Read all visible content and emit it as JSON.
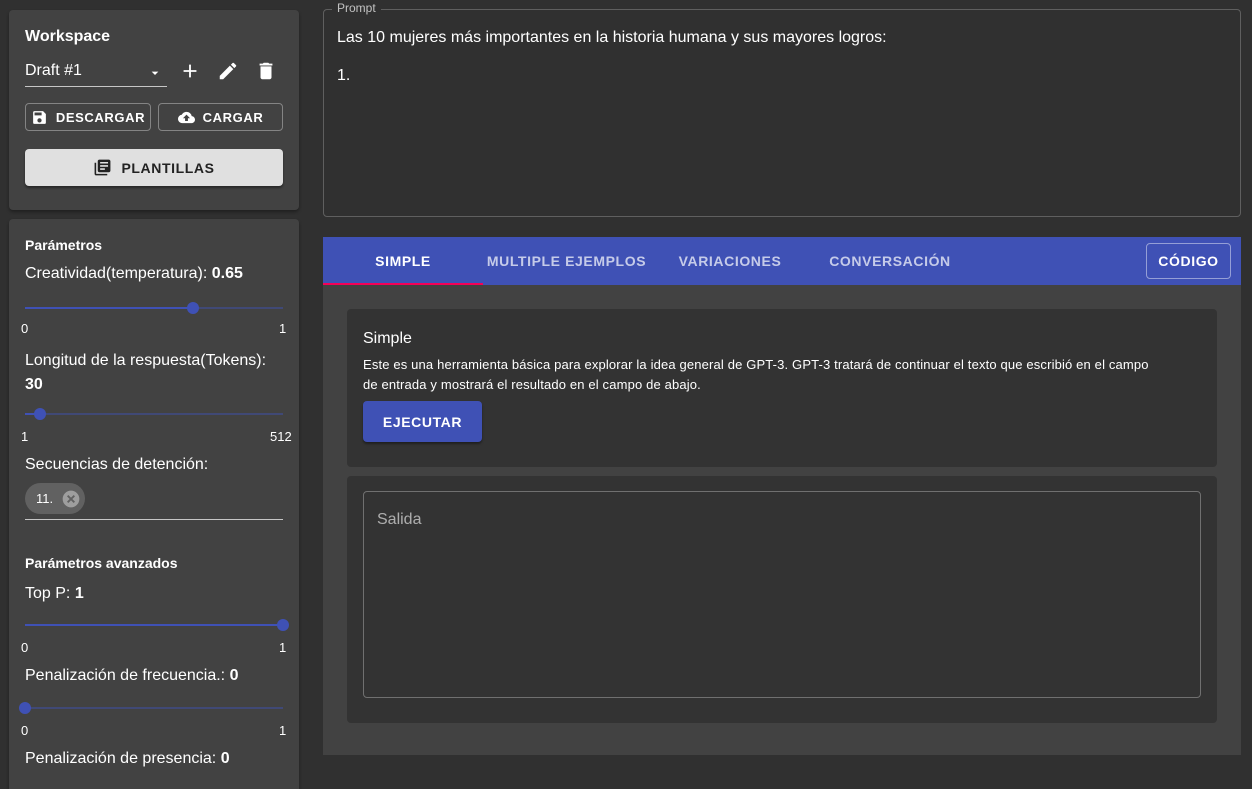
{
  "workspace": {
    "title": "Workspace",
    "draft_select": "Draft #1",
    "download_label": "DESCARGAR",
    "upload_label": "CARGAR",
    "templates_label": "PLANTILLAS"
  },
  "parameters": {
    "title": "Parámetros",
    "temperature": {
      "label": "Creatividad(temperatura): ",
      "value": "0.65",
      "min_label": "0",
      "max_label": "1",
      "fraction": 0.65
    },
    "max_tokens": {
      "label": "Longitud de la respuesta(Tokens):",
      "value": "30",
      "min_label": "1",
      "max_label": "512",
      "fraction": 0.057
    },
    "stop_sequences": {
      "label": "Secuencias de detención:",
      "chips": [
        "11."
      ]
    },
    "advanced_title": "Parámetros avanzados",
    "top_p": {
      "label": "Top P: ",
      "value": "1",
      "min_label": "0",
      "max_label": "1",
      "fraction": 1.0
    },
    "frequency_penalty": {
      "label": "Penalización de frecuencia.: ",
      "value": "0",
      "min_label": "0",
      "max_label": "1",
      "fraction": 0.0
    },
    "presence_penalty": {
      "label": "Penalización de presencia: ",
      "value": "0"
    }
  },
  "prompt": {
    "legend": "Prompt",
    "line1": "Las 10 mujeres más importantes en la historia humana y sus mayores logros:",
    "line2": "1."
  },
  "tabs": {
    "items": [
      "SIMPLE",
      "MULTIPLE EJEMPLOS",
      "VARIACIONES",
      "CONVERSACIÓN"
    ],
    "active": "SIMPLE",
    "code_label": "CÓDIGO"
  },
  "simple": {
    "title": "Simple",
    "description_line1": "Este es una herramienta básica para explorar la idea general de GPT-3. GPT-3 tratará de continuar el texto que escribió en el campo",
    "description_line2": "de entrada y mostrará el resultado en el campo de abajo.",
    "run_label": "EJECUTAR",
    "output_placeholder": "Salida"
  },
  "colors": {
    "primary": "#3f51b5",
    "accent": "#f50057",
    "background": "#303030",
    "paper": "#424242"
  }
}
